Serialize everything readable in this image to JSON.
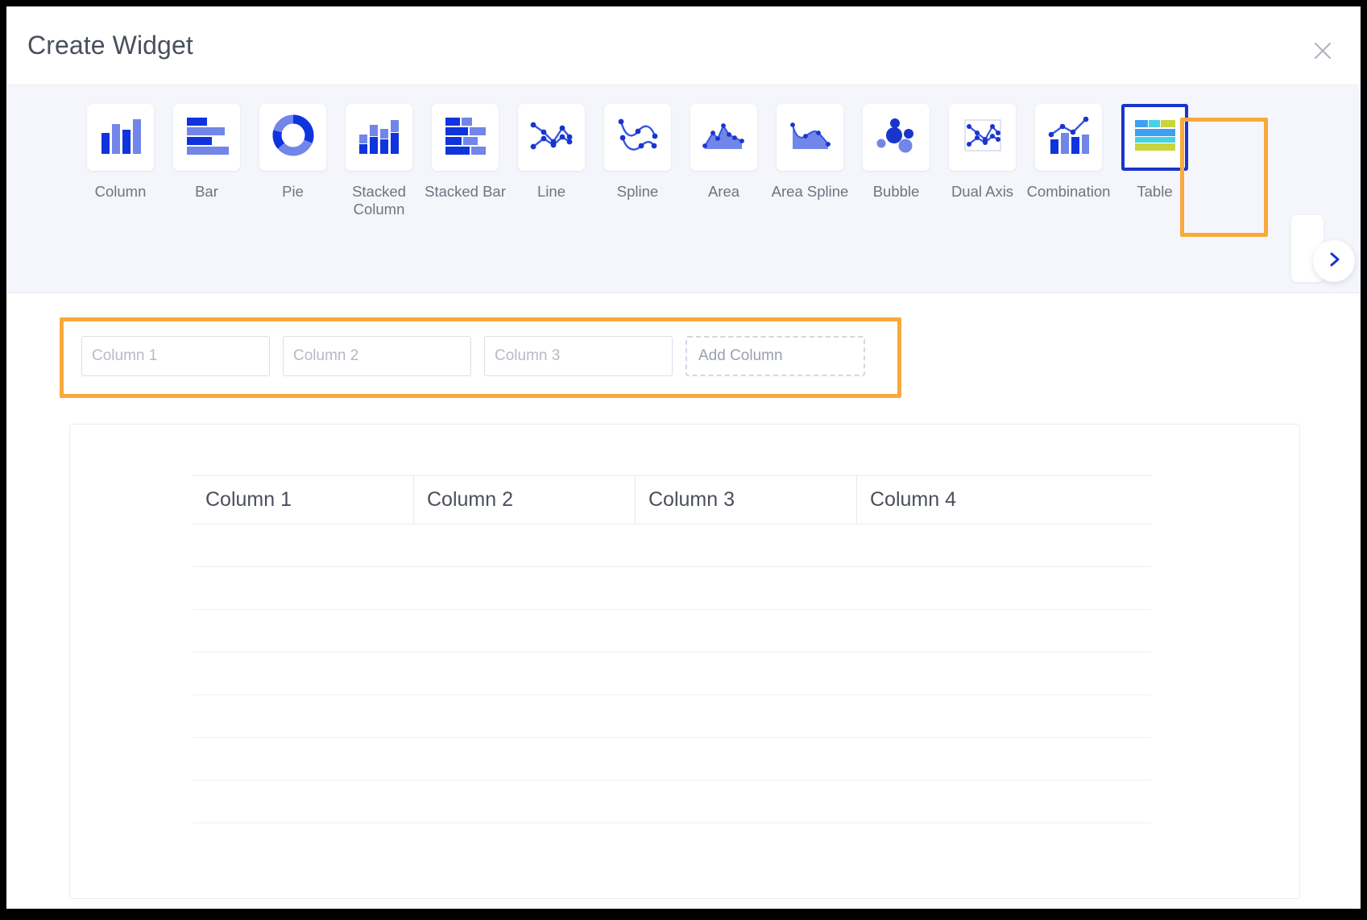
{
  "window": {
    "title": "Create Widget",
    "close_icon": "close-icon"
  },
  "chart_types": {
    "items": [
      {
        "label": "Column",
        "icon": "column-chart-icon",
        "selected": false
      },
      {
        "label": "Bar",
        "icon": "bar-chart-icon",
        "selected": false
      },
      {
        "label": "Pie",
        "icon": "pie-chart-icon",
        "selected": false
      },
      {
        "label": "Stacked\nColumn",
        "icon": "stacked-column-icon",
        "selected": false
      },
      {
        "label": "Stacked Bar",
        "icon": "stacked-bar-icon",
        "selected": false
      },
      {
        "label": "Line",
        "icon": "line-chart-icon",
        "selected": false
      },
      {
        "label": "Spline",
        "icon": "spline-chart-icon",
        "selected": false
      },
      {
        "label": "Area",
        "icon": "area-chart-icon",
        "selected": false
      },
      {
        "label": "Area Spline",
        "icon": "area-spline-chart-icon",
        "selected": false
      },
      {
        "label": "Bubble",
        "icon": "bubble-chart-icon",
        "selected": false
      },
      {
        "label": "Dual Axis",
        "icon": "dual-axis-chart-icon",
        "selected": false
      },
      {
        "label": "Combination",
        "icon": "combination-chart-icon",
        "selected": false
      },
      {
        "label": "Table",
        "icon": "table-icon",
        "selected": true
      }
    ],
    "next_icon": "chevron-right-icon"
  },
  "columns": {
    "inputs": [
      {
        "value": "",
        "placeholder": "Column 1"
      },
      {
        "value": "",
        "placeholder": "Column 2"
      },
      {
        "value": "",
        "placeholder": "Column 3"
      }
    ],
    "add_label": "Add Column"
  },
  "chart_data": {
    "type": "table",
    "title": "",
    "columns": [
      "Column 1",
      "Column 2",
      "Column 3",
      "Column 4"
    ],
    "rows": [
      [
        "",
        "",
        "",
        ""
      ],
      [
        "",
        "",
        "",
        ""
      ],
      [
        "",
        "",
        "",
        ""
      ],
      [
        "",
        "",
        "",
        ""
      ],
      [
        "",
        "",
        "",
        ""
      ],
      [
        "",
        "",
        "",
        ""
      ],
      [
        "",
        "",
        "",
        ""
      ]
    ],
    "grid": true,
    "legend": "none"
  },
  "colors": {
    "accent_blue": "#1935ce",
    "icon_blue_dark": "#0f34de",
    "icon_blue_light": "#7186e8",
    "highlight_orange": "#f9a93c",
    "strip_bg": "#f5f6fc",
    "table_icon_blue": "#3fa0f0",
    "table_icon_cyan": "#46d2e0",
    "table_icon_green": "#c8d63c",
    "text_primary": "#4a4f5c",
    "text_muted": "#6f7482",
    "placeholder": "#b6bac5"
  }
}
